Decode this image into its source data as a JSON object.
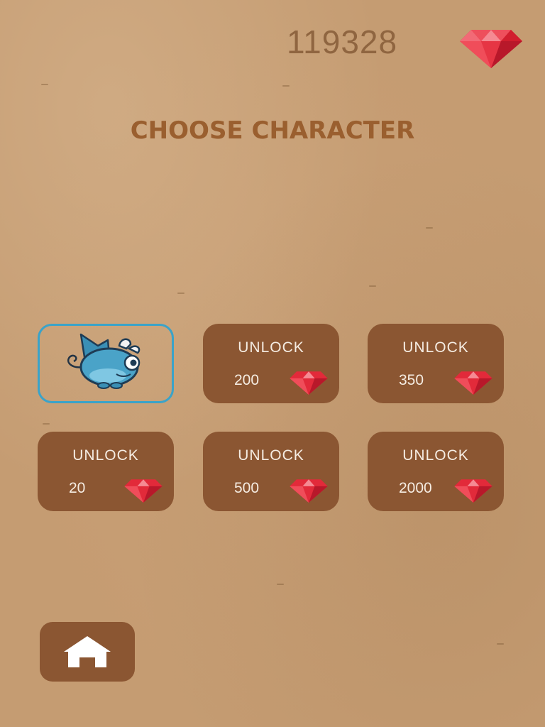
{
  "header": {
    "gem_count": "119328",
    "gem_icon": "ruby-gem-icon"
  },
  "title": "CHOOSE CHARACTER",
  "characters": [
    {
      "id": "blue-dragon",
      "selected": true,
      "locked": false,
      "icon": "blue-dragon-character"
    },
    {
      "locked": true,
      "unlock_label": "UNLOCK",
      "price": "200"
    },
    {
      "locked": true,
      "unlock_label": "UNLOCK",
      "price": "350"
    },
    {
      "locked": true,
      "unlock_label": "UNLOCK",
      "price": "20"
    },
    {
      "locked": true,
      "unlock_label": "UNLOCK",
      "price": "500"
    },
    {
      "locked": true,
      "unlock_label": "UNLOCK",
      "price": "2000"
    }
  ],
  "home_button": {
    "icon": "home-icon"
  },
  "colors": {
    "background": "#c59c72",
    "card": "#8b5632",
    "title": "#9a5f2f",
    "selected_border": "#3aa3c9",
    "gem": "#e8343f"
  }
}
